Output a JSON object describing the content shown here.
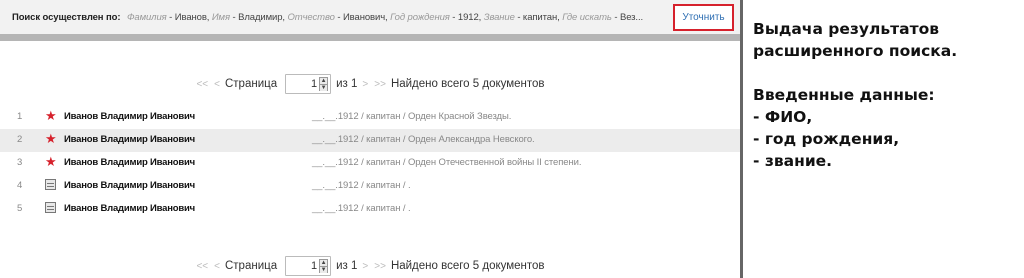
{
  "criteria": {
    "prefix": "Поиск осуществлен по:",
    "items": [
      {
        "key": "Фамилия",
        "value": "Иванов"
      },
      {
        "key": "Имя",
        "value": "Владимир"
      },
      {
        "key": "Отчество",
        "value": "Иванович"
      },
      {
        "key": "Год рождения",
        "value": "1912"
      },
      {
        "key": "Звание",
        "value": "капитан"
      },
      {
        "key": "Где искать",
        "value": "Вез..."
      }
    ],
    "separator": " - ",
    "item_separator": ", "
  },
  "refine_button": "Уточнить",
  "pager": {
    "first": "<<",
    "prev": "<",
    "page_label": "Страница",
    "page_value": "1",
    "of_label": "из 1",
    "next": ">",
    "last": ">>",
    "found": "Найдено всего 5 документов"
  },
  "results": [
    {
      "num": "1",
      "icon": "star-icon",
      "name": "Иванов Владимир Иванович",
      "info": "__.__.1912 / капитан / Орден Красной Звезды."
    },
    {
      "num": "2",
      "icon": "star-icon",
      "name": "Иванов Владимир Иванович",
      "info": "__.__.1912 / капитан / Орден Александра Невского."
    },
    {
      "num": "3",
      "icon": "star-icon",
      "name": "Иванов Владимир Иванович",
      "info": "__.__.1912 / капитан / Орден Отечественной войны II степени."
    },
    {
      "num": "4",
      "icon": "document-icon",
      "name": "Иванов Владимир Иванович",
      "info": "__.__.1912 / капитан / ."
    },
    {
      "num": "5",
      "icon": "document-icon",
      "name": "Иванов Владимир Иванович",
      "info": "__.__.1912 / капитан / ."
    }
  ],
  "annotation": {
    "line1": "Выдача результатов",
    "line2": "расширенного поиска.",
    "line3": "Введенные данные:",
    "line4": "- ФИО,",
    "line5": "- год рождения,",
    "line6": "- звание."
  },
  "colors": {
    "accent_red": "#d6212c",
    "link_blue": "#2f6fb3"
  }
}
